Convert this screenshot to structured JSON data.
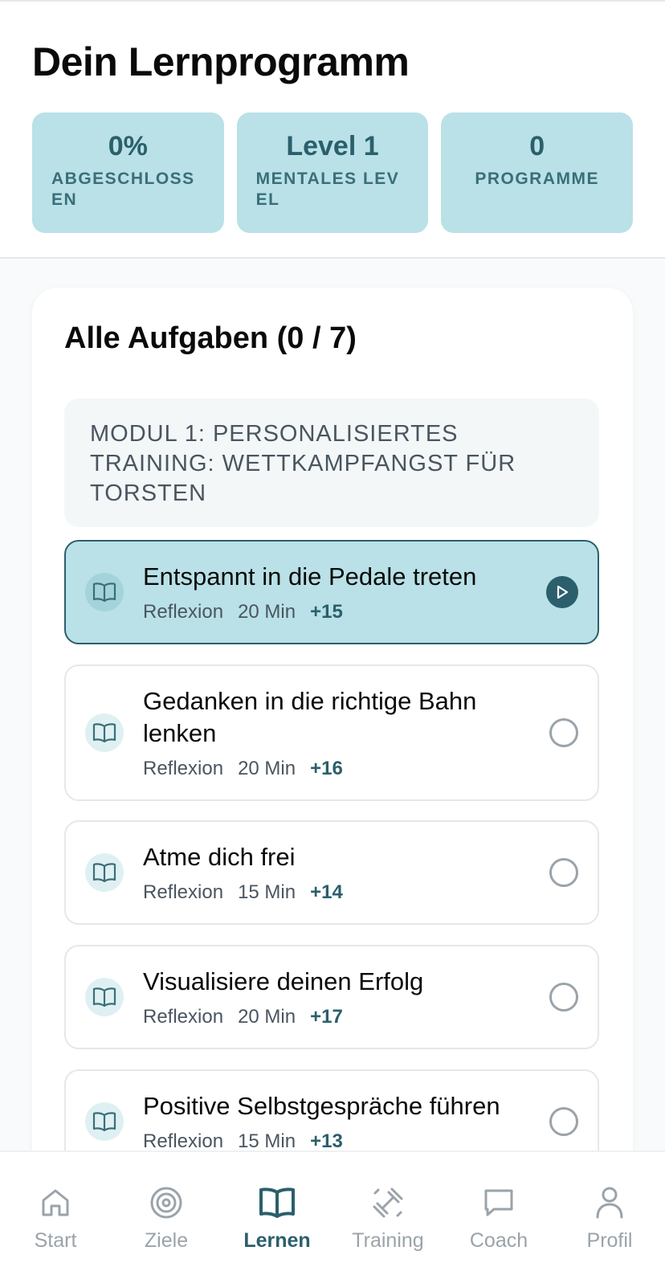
{
  "header": {
    "title": "Dein Lernprogramm",
    "stats": [
      {
        "value": "0%",
        "label": "ABGESCHLOSSEN"
      },
      {
        "value": "Level 1",
        "label": "MENTALES LEVEL"
      },
      {
        "value": "0",
        "label": "PROGRAMME"
      }
    ]
  },
  "tasks_card": {
    "title": "Alle Aufgaben (0 / 7)",
    "module_title": "MODUL 1: PERSONALISIERTES TRAINING: WETTKAMPFANGST FÜR TORSTEN",
    "tasks": [
      {
        "title": "Entspannt in die Pedale treten",
        "type": "Reflexion",
        "duration": "20 Min",
        "points": "+15",
        "status": "current"
      },
      {
        "title": "Gedanken in die richtige Bahn lenken",
        "type": "Reflexion",
        "duration": "20 Min",
        "points": "+16",
        "status": "open"
      },
      {
        "title": "Atme dich frei",
        "type": "Reflexion",
        "duration": "15 Min",
        "points": "+14",
        "status": "open"
      },
      {
        "title": "Visualisiere deinen Erfolg",
        "type": "Reflexion",
        "duration": "20 Min",
        "points": "+17",
        "status": "open"
      },
      {
        "title": "Positive Selbstgespräche führen",
        "type": "Reflexion",
        "duration": "15 Min",
        "points": "+13",
        "status": "open"
      }
    ]
  },
  "bottom_nav": {
    "items": [
      {
        "label": "Start",
        "icon": "home-icon"
      },
      {
        "label": "Ziele",
        "icon": "target-icon"
      },
      {
        "label": "Lernen",
        "icon": "book-icon",
        "active": true
      },
      {
        "label": "Training",
        "icon": "dumbbell-icon"
      },
      {
        "label": "Coach",
        "icon": "chat-icon"
      },
      {
        "label": "Profil",
        "icon": "user-icon"
      }
    ]
  },
  "colors": {
    "accent": "#2b5f6b",
    "stat_bg": "#b9e1e7",
    "inactive": "#9aa3aa"
  }
}
